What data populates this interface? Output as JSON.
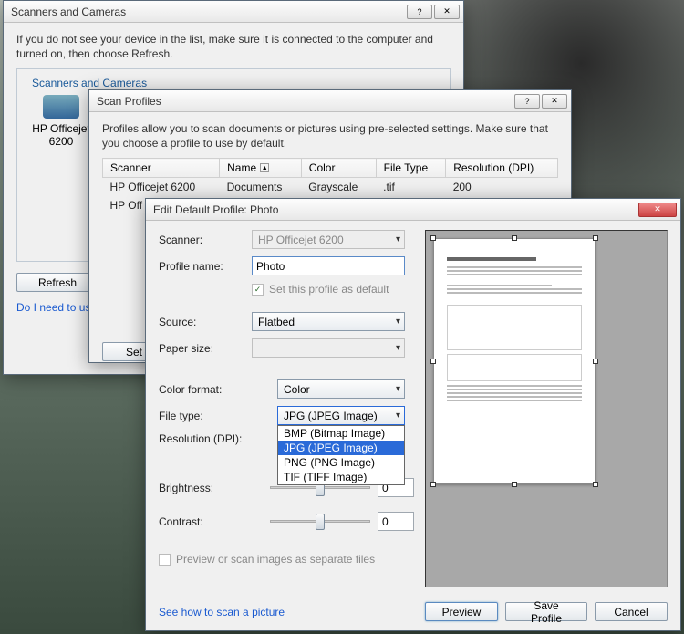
{
  "win1": {
    "title": "Scanners and Cameras",
    "desc": "If you do not see your device in the list, make sure it is connected to the computer and turned on, then choose Refresh.",
    "group_title": "Scanners and Cameras",
    "device_name": "HP Officejet 6200",
    "refresh": "Refresh",
    "help_link": "Do I need to use"
  },
  "win2": {
    "title": "Scan Profiles",
    "desc": "Profiles allow you to scan documents or pictures using pre-selected settings. Make sure that you choose a profile to use by default.",
    "cols": {
      "scanner": "Scanner",
      "name": "Name",
      "color": "Color",
      "filetype": "File Type",
      "res": "Resolution (DPI)"
    },
    "rows": [
      {
        "scanner": "HP Officejet 6200",
        "name": "Documents",
        "color": "Grayscale",
        "filetype": ".tif",
        "res": "200"
      },
      {
        "scanner": "HP Off",
        "name": "",
        "color": "",
        "filetype": "",
        "res": ""
      }
    ],
    "set_btn": "Set"
  },
  "win3": {
    "title": "Edit Default Profile: Photo",
    "labels": {
      "scanner": "Scanner:",
      "profile": "Profile name:",
      "default": "Set this profile as default",
      "source": "Source:",
      "paper": "Paper size:",
      "colorfmt": "Color format:",
      "filetype": "File type:",
      "res": "Resolution (DPI):",
      "brightness": "Brightness:",
      "contrast": "Contrast:",
      "sepfiles": "Preview or scan images as separate files",
      "howto": "See how to scan a picture"
    },
    "values": {
      "scanner": "HP Officejet 6200",
      "profile": "Photo",
      "source": "Flatbed",
      "colorfmt": "Color",
      "filetype": "JPG (JPEG Image)",
      "brightness": "0",
      "contrast": "0"
    },
    "filetype_options": [
      "BMP (Bitmap Image)",
      "JPG (JPEG Image)",
      "PNG (PNG Image)",
      "TIF (TIFF Image)"
    ],
    "buttons": {
      "preview": "Preview",
      "save": "Save Profile",
      "cancel": "Cancel"
    }
  }
}
